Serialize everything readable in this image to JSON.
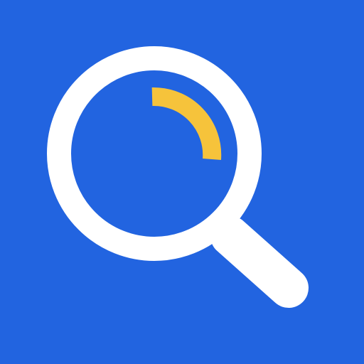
{
  "icon": {
    "name": "magnifying-glass-icon",
    "colors": {
      "background": "#2264e0",
      "lens_ring": "#ffffff",
      "handle": "#ffffff",
      "highlight_arc": "#f6c33b"
    }
  }
}
